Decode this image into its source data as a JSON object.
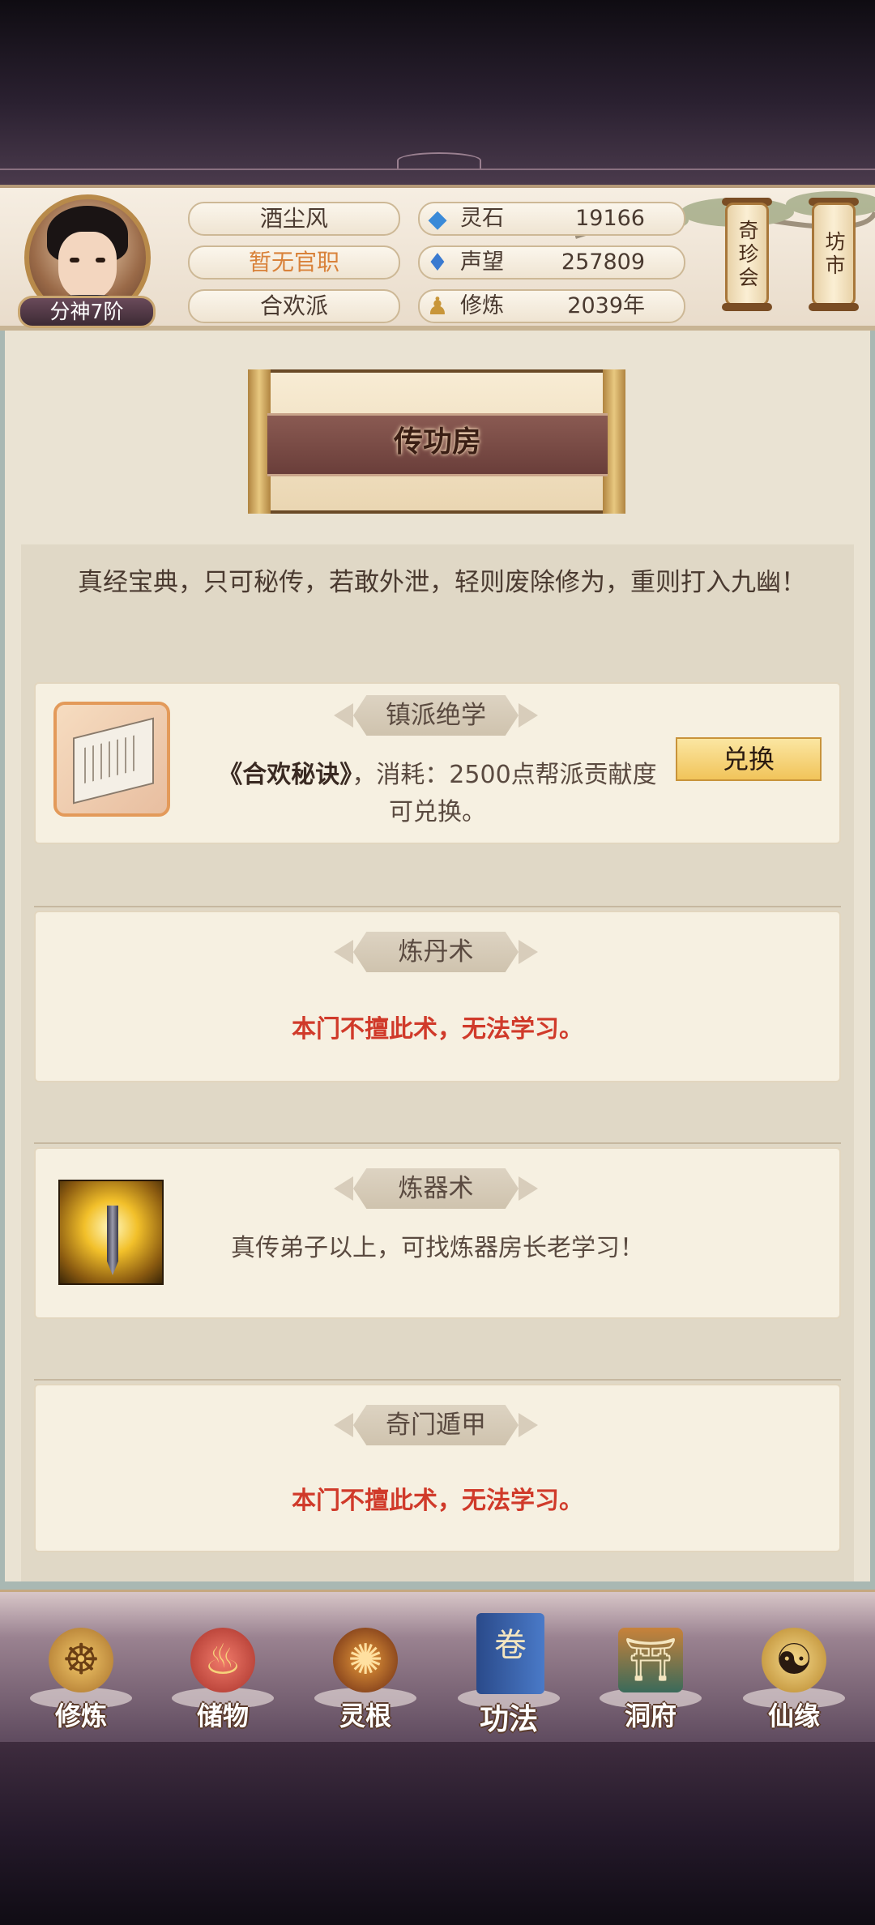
{
  "header": {
    "rank": "分神7阶",
    "name": "酒尘风",
    "title": "暂无官职",
    "sect": "合欢派",
    "stats": [
      {
        "icon": "spirit-stone-icon",
        "label": "灵石",
        "value": "19166"
      },
      {
        "icon": "reputation-icon",
        "label": "声望",
        "value": "257809"
      },
      {
        "icon": "cultivation-icon",
        "label": "修炼",
        "value": "2039年"
      }
    ],
    "scroll_buttons": [
      "奇珍会",
      "坊市"
    ]
  },
  "page_title": "传功房",
  "intro": "真经宝典，只可秘传，若敢外泄，轻则废除修为，重则打入九幽！",
  "cards": [
    {
      "title": "镇派绝学",
      "book": "《合欢秘诀》",
      "text": "，消耗：2500点帮派贡献度可兑换。",
      "button": "兑换",
      "icon": "book-icon"
    },
    {
      "title": "炼丹术",
      "text": "本门不擅此术，无法学习。"
    },
    {
      "title": "炼器术",
      "text": "真传弟子以上，可找炼器房长老学习！",
      "icon": "sword-icon"
    },
    {
      "title": "奇门遁甲",
      "text": "本门不擅此术，无法学习。"
    }
  ],
  "nav": [
    {
      "label": "修炼",
      "icon": "meditation-icon"
    },
    {
      "label": "储物",
      "icon": "storage-bag-icon"
    },
    {
      "label": "灵根",
      "icon": "spirit-root-icon"
    },
    {
      "label": "功法",
      "icon": "scripture-icon",
      "active": true
    },
    {
      "label": "洞府",
      "icon": "cave-mansion-icon"
    },
    {
      "label": "仙缘",
      "icon": "gourd-icon"
    }
  ],
  "colors": {
    "red_text": "#d03a2a",
    "title_ribbon": "#7a4a44",
    "panel_bg": "#eae3d3"
  }
}
